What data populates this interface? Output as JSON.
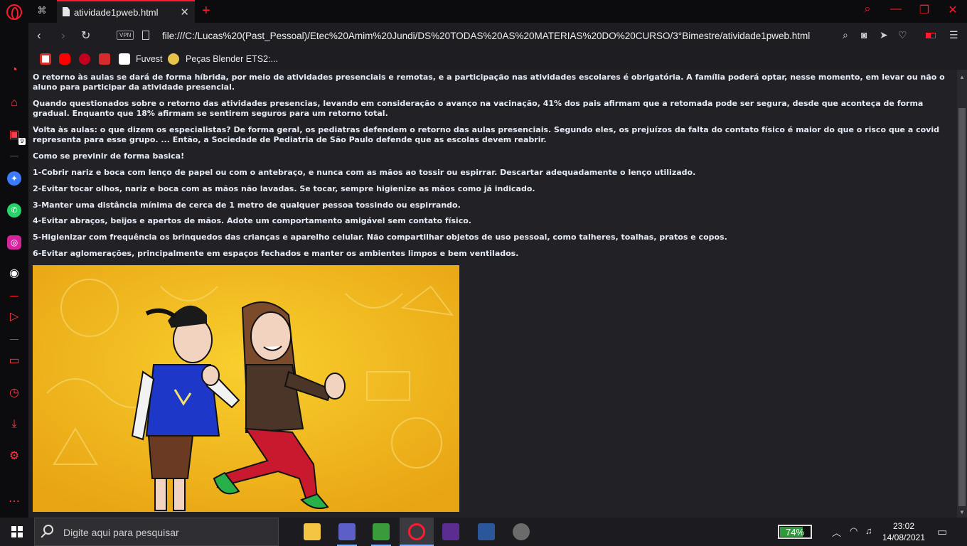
{
  "browser": {
    "tab_title": "atividade1pweb.html",
    "url": "file:///C:/Lucas%20(Past_Pessoal)/Etec%20Amim%20Jundi/DS%20TODAS%20AS%20MATERIAS%20DO%20CURSO/3°Bimestre/atividade1pweb.html",
    "vpn_label": "VPN",
    "sidebar_badge": "9"
  },
  "bookmarks": [
    {
      "label": "Fuvest"
    },
    {
      "label": "Peças Blender ETS2:..."
    }
  ],
  "content": {
    "paragraphs": [
      "O retorno às aulas se dará de forma híbrida, por meio de atividades presenciais e remotas, e a participação nas atividades escolares é obrigatória. A família poderá optar, nesse momento, em levar ou não o aluno para participar da atividade presencial.",
      "Quando questionados sobre o retorno das atividades presencias, levando em consideração o avanço na vacinação, 41% dos pais afirmam que a retomada pode ser segura, desde que aconteça de forma gradual. Enquanto que 18% afirmam se sentirem seguros para um retorno total.",
      "Volta às aulas: o que dizem os especialistas? De forma geral, os pediatras defendem o retorno das aulas presenciais. Segundo eles, os prejuízos da falta do contato físico é maior do que o risco que a covid representa para esse grupo. ... Então, a Sociedade de Pediatria de São Paulo defende que as escolas devem reabrir.",
      "Como se previnir de forma basica!",
      "1-Cobrir nariz e boca com lenço de papel ou com o antebraço, e nunca com as mãos ao tossir ou espirrar. Descartar adequadamente o lenço utilizado.",
      "2-Evitar tocar olhos, nariz e boca com as mãos não lavadas. Se tocar, sempre higienize as mãos como já indicado.",
      "3-Manter uma distância mínima de cerca de 1 metro de qualquer pessoa tossindo ou espirrando.",
      "4-Evitar abraços, beijos e apertos de mãos. Adote um comportamento amigável sem contato físico.",
      "5-Higienizar com frequência os brinquedos das crianças e aparelho celular. Não compartilhar objetos de uso pessoal, como talheres, toalhas, pratos e copos.",
      "6-Evitar aglomerações, principalmente em espaços fechados e manter os ambientes limpos e bem ventilados."
    ]
  },
  "taskbar": {
    "search_placeholder": "Digite aqui para pesquisar",
    "battery_percent": "74%",
    "time": "23:02",
    "date": "14/08/2021"
  },
  "colors": {
    "accent": "#ff1b2d",
    "page_bg": "#222226",
    "text": "#e6ebf5",
    "illustration_bg": "#f2b61a"
  }
}
